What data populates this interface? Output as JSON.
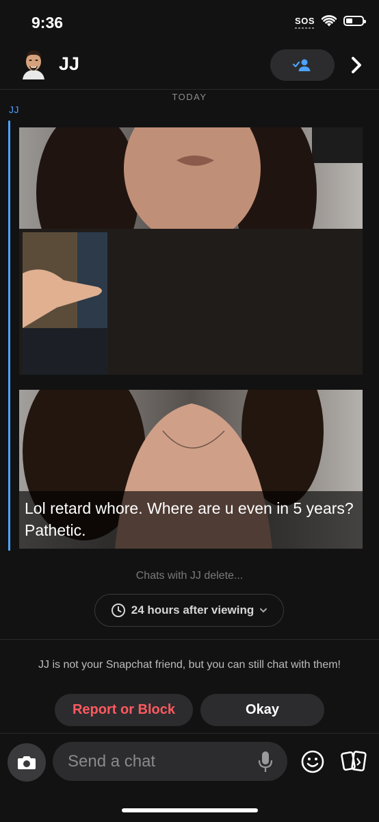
{
  "status_bar": {
    "time": "9:36",
    "sos": "SOS"
  },
  "header": {
    "name": "JJ"
  },
  "conversation": {
    "date_label": "TODAY",
    "sender": "JJ",
    "caption": "Lol retard whore.  Where are u even in 5 years? Pathetic."
  },
  "retention": {
    "note": "Chats with JJ delete...",
    "setting": "24 hours after viewing"
  },
  "friend_notice": {
    "text": "JJ is not your Snapchat friend, but you can still chat with them!",
    "report_label": "Report or Block",
    "okay_label": "Okay"
  },
  "composer": {
    "placeholder": "Send a chat"
  },
  "colors": {
    "accent": "#4da3ff",
    "danger": "#ff5a60",
    "background": "#121212"
  }
}
